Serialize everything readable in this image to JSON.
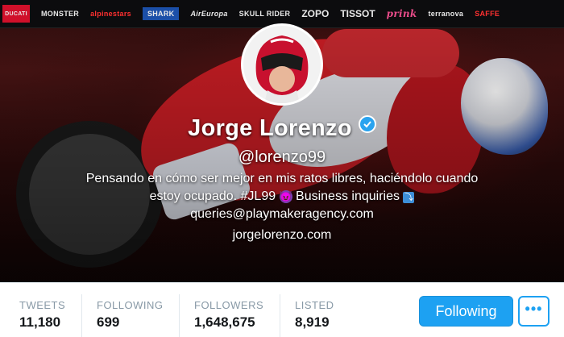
{
  "sponsors": [
    {
      "label": "DUCATI",
      "style": "ducati"
    },
    {
      "label": "MONSTER",
      "style": ""
    },
    {
      "label": "alpinestars",
      "style": "red"
    },
    {
      "label": "SHARK",
      "style": "blue"
    },
    {
      "label": "AirEuropa",
      "style": "ital"
    },
    {
      "label": "SKULL RIDER",
      "style": ""
    },
    {
      "label": "ZOPO",
      "style": "big"
    },
    {
      "label": "TISSOT",
      "style": "big"
    },
    {
      "label": "prink",
      "style": "serif"
    },
    {
      "label": "terranova",
      "style": ""
    },
    {
      "label": "SAFFE",
      "style": "red"
    }
  ],
  "profile": {
    "name": "Jorge Lorenzo",
    "verified_icon": "verified-badge-icon",
    "handle": "@lorenzo99",
    "bio_line1": "Pensando en cómo ser mejor en mis ratos libres, haciéndolo cuando",
    "bio_line2_a": "estoy ocupado. #JL99",
    "bio_emoji": "😈",
    "bio_line2_b": "Business inquiries",
    "bio_arrow": "⤵",
    "bio_line3": "queries@playmakeragency.com",
    "url": "jorgelorenzo.com"
  },
  "stats": [
    {
      "label": "TWEETS",
      "value": "11,180"
    },
    {
      "label": "FOLLOWING",
      "value": "699"
    },
    {
      "label": "FOLLOWERS",
      "value": "1,648,675"
    },
    {
      "label": "LISTED",
      "value": "8,919"
    }
  ],
  "actions": {
    "follow_label": "Following",
    "more_label": "•••"
  },
  "colors": {
    "accent": "#1da1f2",
    "stat_label": "#8899a6",
    "stat_value": "#14171a"
  }
}
